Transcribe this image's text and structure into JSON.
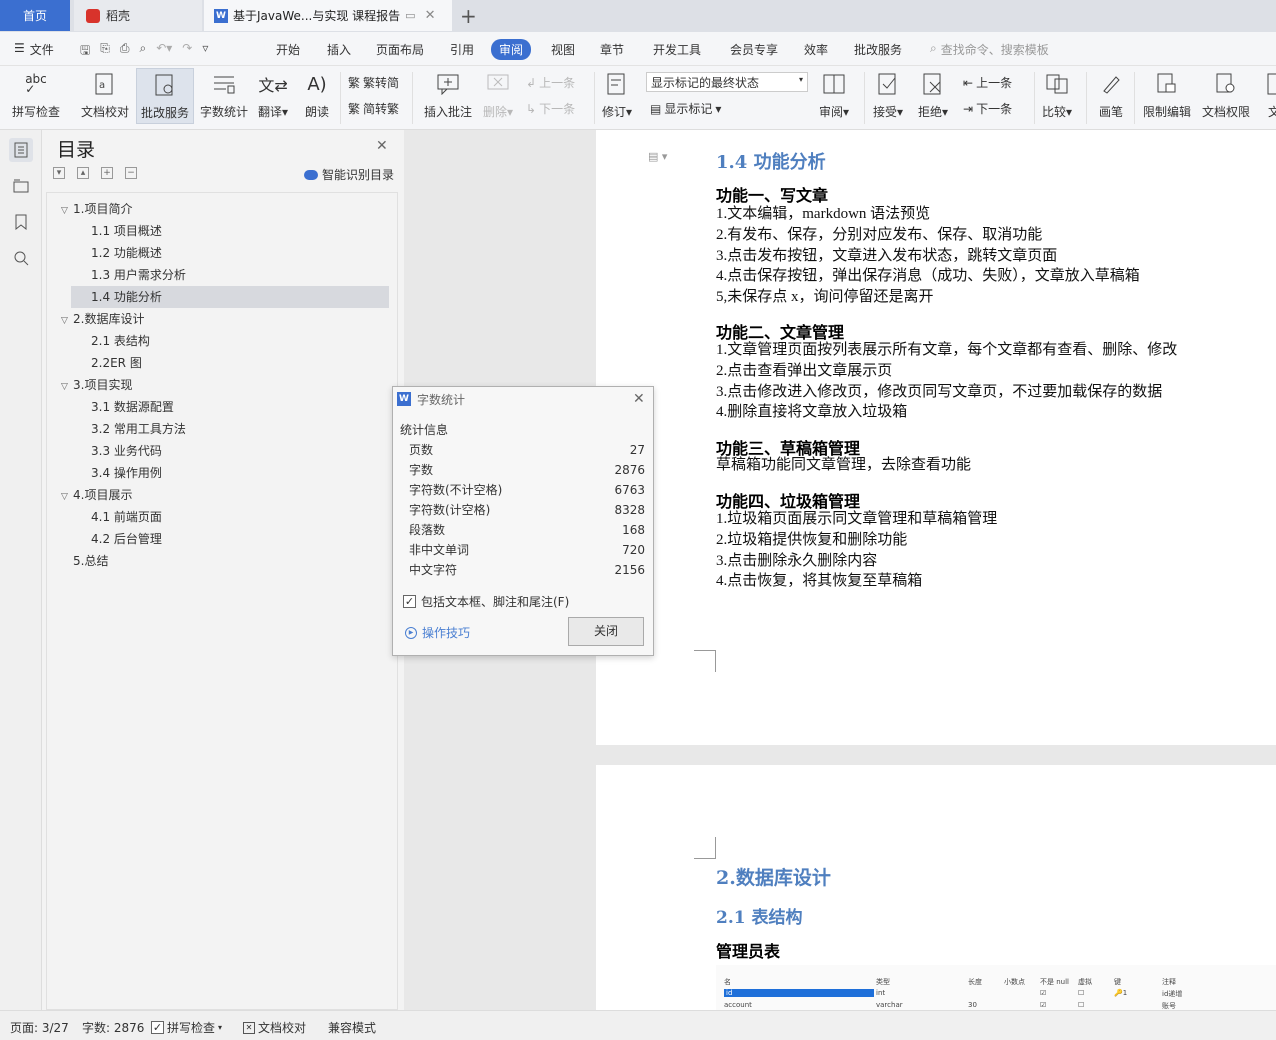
{
  "tabs": {
    "home": "首页",
    "daoke": "稻壳",
    "doc": "基于JavaWe...与实现 课程报告"
  },
  "menu": {
    "file": "文件",
    "items": [
      "开始",
      "插入",
      "页面布局",
      "引用",
      "审阅",
      "视图",
      "章节",
      "开发工具",
      "会员专享",
      "效率",
      "批改服务"
    ],
    "search_placeholder": "查找命令、搜索模板"
  },
  "ribbon": {
    "spell": "拼写检查",
    "proof": "文档校对",
    "grading": "批改服务",
    "wordcount": "字数统计",
    "translate": "翻译",
    "read": "朗读",
    "to_trad": "繁转简",
    "to_simp": "简转繁",
    "insert_comment": "插入批注",
    "delete": "删除",
    "prev_comment": "上一条",
    "next_comment": "下一条",
    "track": "修订",
    "markup_state": "显示标记的最终状态",
    "show_markup": "显示标记",
    "review": "审阅",
    "accept": "接受",
    "reject": "拒绝",
    "prev_change": "上一条",
    "next_change": "下一条",
    "compare": "比较",
    "pen": "画笔",
    "restrict": "限制编辑",
    "permission": "文档权限",
    "more": "文"
  },
  "toc": {
    "title": "目录",
    "smart": "智能识别目录",
    "items": [
      {
        "label": "1.项目简介",
        "level": 1
      },
      {
        "label": "1.1 项目概述",
        "level": 2
      },
      {
        "label": "1.2 功能概述",
        "level": 2
      },
      {
        "label": "1.3 用户需求分析",
        "level": 2
      },
      {
        "label": "1.4 功能分析",
        "level": 2,
        "selected": true
      },
      {
        "label": "2.数据库设计",
        "level": 1
      },
      {
        "label": "2.1 表结构",
        "level": 2
      },
      {
        "label": "2.2ER 图",
        "level": 2
      },
      {
        "label": "3.项目实现",
        "level": 1
      },
      {
        "label": "3.1 数据源配置",
        "level": 2
      },
      {
        "label": "3.2 常用工具方法",
        "level": 2
      },
      {
        "label": "3.3 业务代码",
        "level": 2
      },
      {
        "label": "3.4 操作用例",
        "level": 2
      },
      {
        "label": "4.项目展示",
        "level": 1
      },
      {
        "label": "4.1 前端页面",
        "level": 2
      },
      {
        "label": "4.2 后台管理",
        "level": 2
      },
      {
        "label": "5.总结",
        "level": 1,
        "leaf": true
      }
    ]
  },
  "doc": {
    "heading": "1.4 功能分析",
    "sec1": {
      "title": "功能一、写文章",
      "lines": [
        "1.文本编辑，markdown 语法预览",
        "2.有发布、保存，分别对应发布、保存、取消功能",
        "3.点击发布按钮，文章进入发布状态，跳转文章页面",
        "4.点击保存按钮，弹出保存消息（成功、失败），文章放入草稿箱",
        "5,未保存点 x，询问停留还是离开"
      ]
    },
    "sec2": {
      "title": "功能二、文章管理",
      "lines": [
        "1.文章管理页面按列表展示所有文章，每个文章都有查看、删除、修改",
        "2.点击查看弹出文章展示页",
        "3.点击修改进入修改页，修改页同写文章页，不过要加载保存的数据",
        "4.删除直接将文章放入垃圾箱"
      ]
    },
    "sec3": {
      "title": "功能三、草稿箱管理",
      "lines": [
        "草稿箱功能同文章管理，去除查看功能"
      ]
    },
    "sec4": {
      "title": "功能四、垃圾箱管理",
      "lines": [
        "1.垃圾箱页面展示同文章管理和草稿箱管理",
        "2.垃圾箱提供恢复和删除功能",
        "3.点击删除永久删除内容",
        "4.点击恢复，将其恢复至草稿箱"
      ]
    },
    "h_db": "2.数据库设计",
    "h_tbl": "2.1 表结构",
    "admin_table": "管理员表",
    "tbl_headers": [
      "名",
      "类型",
      "长度",
      "小数点",
      "不是 null",
      "虚拟",
      "键",
      "注释"
    ],
    "tbl_rows": [
      [
        "id",
        "int",
        "",
        "",
        "☑",
        "☐",
        "🔑1",
        "id递增"
      ],
      [
        "account",
        "varchar",
        "30",
        "",
        "☑",
        "☐",
        "",
        "账号"
      ]
    ]
  },
  "dialog": {
    "title": "字数统计",
    "section": "统计信息",
    "stats": [
      {
        "label": "页数",
        "value": "27"
      },
      {
        "label": "字数",
        "value": "2876"
      },
      {
        "label": "字符数(不计空格)",
        "value": "6763"
      },
      {
        "label": "字符数(计空格)",
        "value": "8328"
      },
      {
        "label": "段落数",
        "value": "168"
      },
      {
        "label": "非中文单词",
        "value": "720"
      },
      {
        "label": "中文字符",
        "value": "2156"
      }
    ],
    "include": "包括文本框、脚注和尾注(F)",
    "tips": "操作技巧",
    "close": "关闭"
  },
  "status": {
    "page": "页面: 3/27",
    "words": "字数: 2876",
    "spell": "拼写检查",
    "proof": "文档校对",
    "compat": "兼容模式"
  },
  "colors": {
    "accent": "#3b6fd0",
    "heading_blue": "#4f7fbf",
    "selected": "#d7d9de"
  }
}
